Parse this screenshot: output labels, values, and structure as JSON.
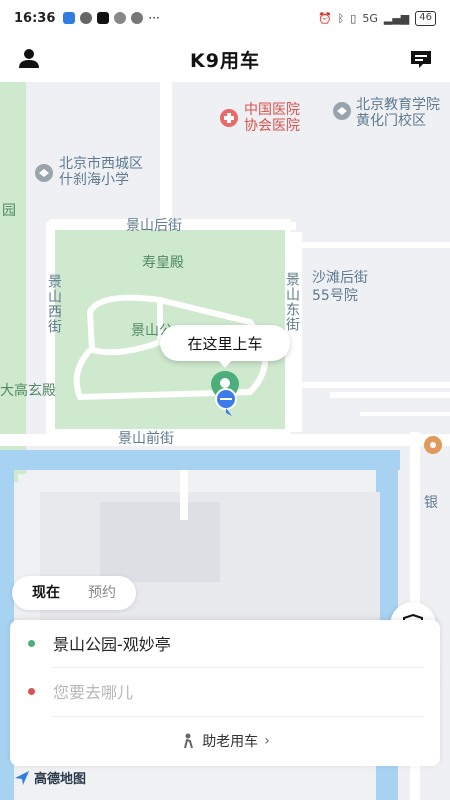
{
  "status_bar": {
    "time": "16:36",
    "network": "5G",
    "battery": "46"
  },
  "header": {
    "title": "K9用车"
  },
  "map": {
    "labels": {
      "hospital": "中国医院\n协会医院",
      "edu_school": "北京教育学院\n黄化门校区",
      "school": "北京市西城区\n什刹海小学",
      "yuan": "园",
      "street_north": "景山后街",
      "palace": "寿皇殿",
      "shatan": "沙滩后街\n55号院",
      "west_street": "景山西街",
      "east_street": "景山东街",
      "park_inner": "景山公",
      "dagaoxuan": "大高玄殿",
      "street_south": "景山前街",
      "bank": "银"
    },
    "pickup_bubble": "在这里上车",
    "amap_logo": "高德地图"
  },
  "mode_tabs": {
    "now": "现在",
    "reserve": "预约"
  },
  "trip": {
    "origin": "景山公园-观妙亭",
    "destination_placeholder": "您要去哪儿",
    "elder_service": "助老用车"
  },
  "colors": {
    "green": "#4caf7a",
    "blue": "#3b7bea",
    "red": "#d9534f",
    "park": "#cfe9cf",
    "water": "#a7d2f2"
  }
}
